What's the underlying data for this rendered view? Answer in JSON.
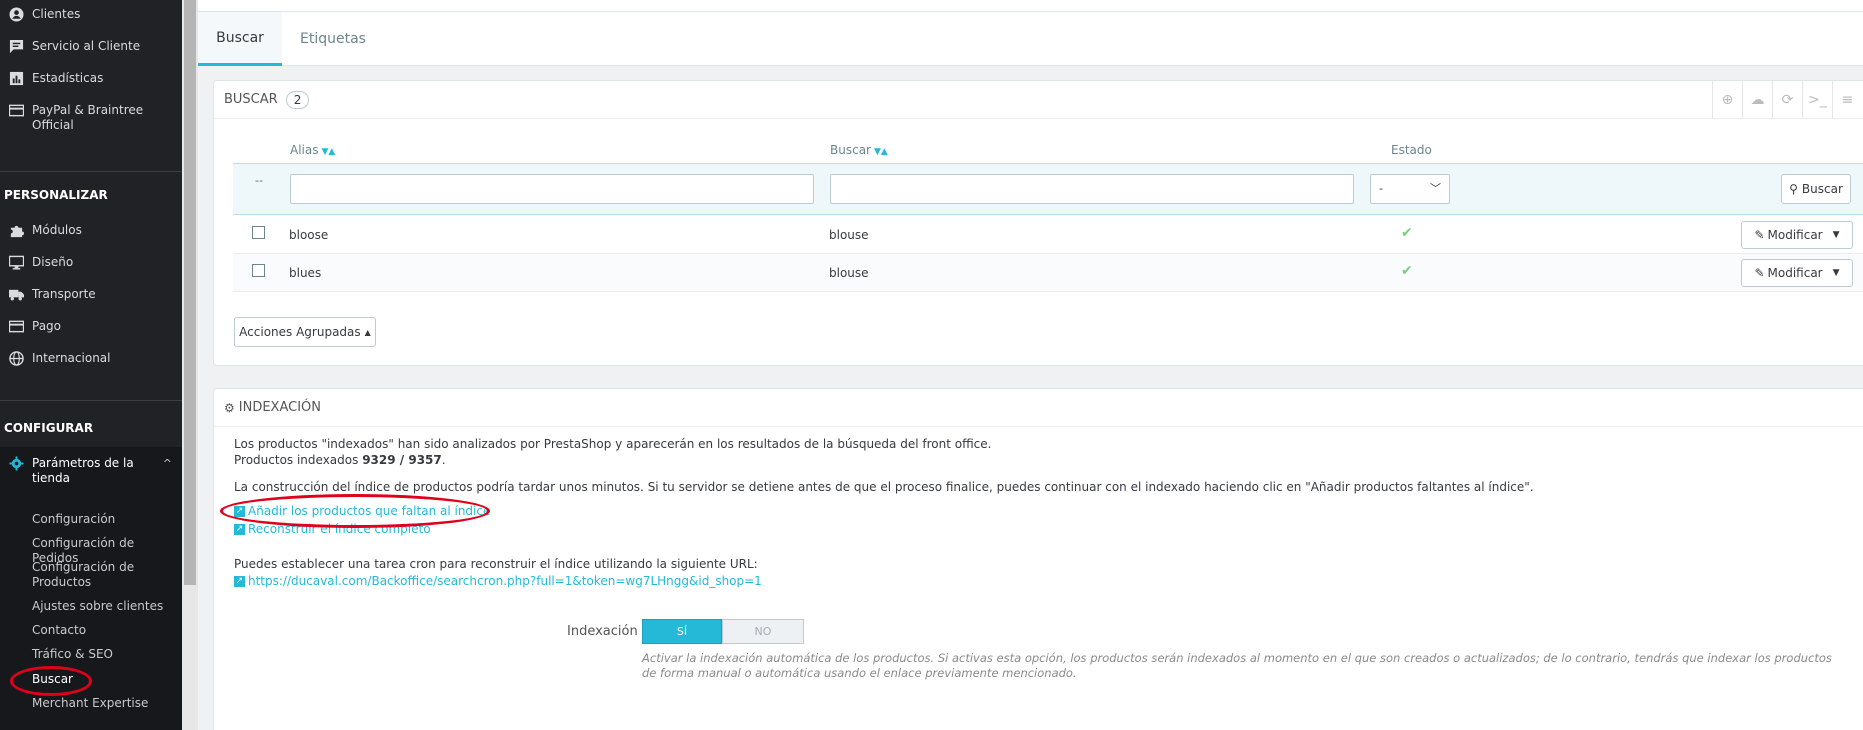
{
  "sidebar": {
    "items_top": [
      {
        "label": "Clientes",
        "icon": "user-icon"
      },
      {
        "label": "Servicio al Cliente",
        "icon": "chat-icon"
      },
      {
        "label": "Estadísticas",
        "icon": "stats-icon"
      },
      {
        "label": "PayPal & Braintree Official",
        "icon": "card-icon"
      }
    ],
    "section_personalizar": "PERSONALIZAR",
    "items_personalizar": [
      {
        "label": "Módulos",
        "icon": "puzzle-icon"
      },
      {
        "label": "Diseño",
        "icon": "monitor-icon"
      },
      {
        "label": "Transporte",
        "icon": "truck-icon"
      },
      {
        "label": "Pago",
        "icon": "card-icon"
      },
      {
        "label": "Internacional",
        "icon": "globe-icon"
      }
    ],
    "section_configurar": "CONFIGURAR",
    "active_parent": "Parámetros de la tienda",
    "subitems": [
      "Configuración",
      "Configuración de Pedidos",
      "Configuración de Productos",
      "Ajustes sobre clientes",
      "Contacto",
      "Tráfico & SEO",
      "Buscar",
      "Merchant Expertise"
    ]
  },
  "tabs": [
    {
      "label": "Buscar",
      "active": true
    },
    {
      "label": "Etiquetas",
      "active": false
    }
  ],
  "list_panel": {
    "title": "BUSCAR",
    "count": "2",
    "columns": {
      "alias": "Alias",
      "buscar": "Buscar",
      "estado": "Estado"
    },
    "filter_placeholder_dash": "--",
    "estado_select_value": "-",
    "search_button": "Buscar",
    "rows": [
      {
        "alias": "bloose",
        "search": "blouse",
        "enabled": true,
        "action": "Modificar"
      },
      {
        "alias": "blues",
        "search": "blouse",
        "enabled": true,
        "action": "Modificar"
      }
    ],
    "bulk_actions": "Acciones Agrupadas"
  },
  "index_panel": {
    "title": "INDEXACIÓN",
    "line1": "Los productos \"indexados\" han sido analizados por PrestaShop y aparecerán en los resultados de la búsqueda del front office.",
    "line2_prefix": "Productos indexados",
    "line2_value": "9329 / 9357",
    "line3": "La construcción del índice de productos podría tardar unos minutos. Si tu servidor se detiene antes de que el proceso finalice, puedes continuar con el indexado haciendo clic en \"Añadir productos faltantes al índice\".",
    "link_add": "Añadir los productos que faltan al índice",
    "link_rebuild": "Reconstruir el índice completo",
    "cron_text": "Puedes establecer una tarea cron para reconstruir el índice utilizando la siguiente URL:",
    "cron_url": "https://ducaval.com/Backoffice/searchcron.php?full=1&token=wg7LHngg&id_shop=1",
    "switch_label": "Indexación",
    "switch_on": "SÍ",
    "switch_off": "NO",
    "help_text": "Activar la indexación automática de los productos. Si activas esta opción, los productos serán indexados al momento en el que son creados o actualizados; de lo contrario, tendrás que indexar los productos de forma manual o automática usando el enlace previamente mencionado."
  },
  "colors": {
    "accent": "#25b9d7",
    "sidebar": "#202226",
    "annotation": "#e0001b",
    "check": "#78d07d"
  }
}
